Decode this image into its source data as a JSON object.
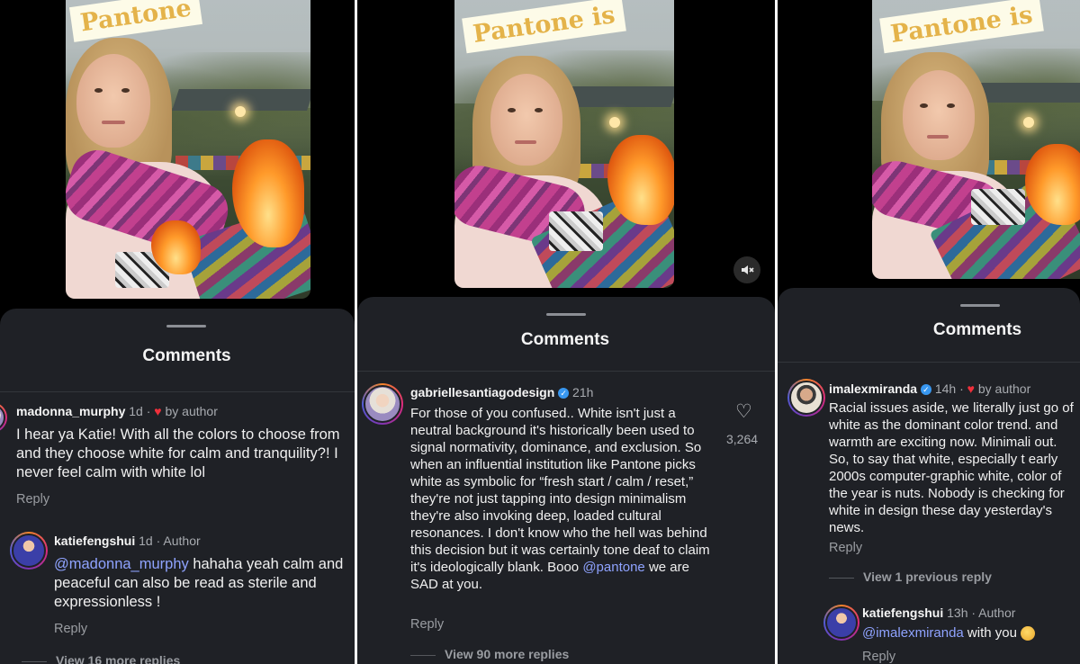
{
  "panels": [
    {
      "story_text": "Pantone",
      "sheet_title": "Comments",
      "comments": [
        {
          "username": "madonna_murphy",
          "time": "1d",
          "liked_by_author": "by author",
          "text": "I hear ya Katie! With all the colors to choose from and they choose white for calm and tranquility?! I never feel calm with white lol",
          "reply": "Reply"
        },
        {
          "username": "katiefengshui",
          "time": "1d",
          "badge": "Author",
          "mention": "@madonna_murphy",
          "text": " hahaha yeah calm and peaceful can also be read as sterile and expressionless !",
          "reply": "Reply"
        }
      ],
      "view_more": "View 16 more replies"
    },
    {
      "story_text": "Pantone is",
      "sheet_title": "Comments",
      "comments": [
        {
          "username": "gabriellesantiagodesign",
          "time": "21h",
          "text": "For those of you confused.. White isn't just a neutral background it's historically been used to signal normativity, dominance, and exclusion. So when an influential institution like Pantone picks white as symbolic for “fresh start / calm / reset,” they're not just tapping into design minimalism they're also invoking deep, loaded cultural resonances. I don't know who the hell was behind this decision but it was certainly tone deaf to claim it's ideologically blank. Booo",
          "mention": "@pantone",
          "text_tail": " we are SAD at you.",
          "likes": "3,264",
          "reply": "Reply"
        }
      ],
      "view_more": "View 90 more replies",
      "mute_icon": "speaker-muted-icon"
    },
    {
      "story_text": "Pantone is",
      "sheet_title": "Comments",
      "comments": [
        {
          "username": "imalexmiranda",
          "time": "14h",
          "liked_by_author": "by author",
          "text": "Racial issues aside, we literally just go of white as the dominant color trend. and warmth are exciting now. Minimali out. So, to say that white, especially t early 2000s computer-graphic white, color of the year is nuts. Nobody is checking for white in design these day yesterday's news.",
          "reply": "Reply"
        },
        {
          "username": "katiefengshui",
          "time": "13h",
          "badge": "Author",
          "mention": "@imalexmiranda",
          "text": " with you",
          "reply": "Reply"
        }
      ],
      "view_previous": "View 1 previous reply"
    }
  ],
  "colors": {
    "sheet_bg": "#1f2126",
    "mention": "#8fa3ff",
    "heart": "#f0303b",
    "verified": "#3897f0"
  }
}
